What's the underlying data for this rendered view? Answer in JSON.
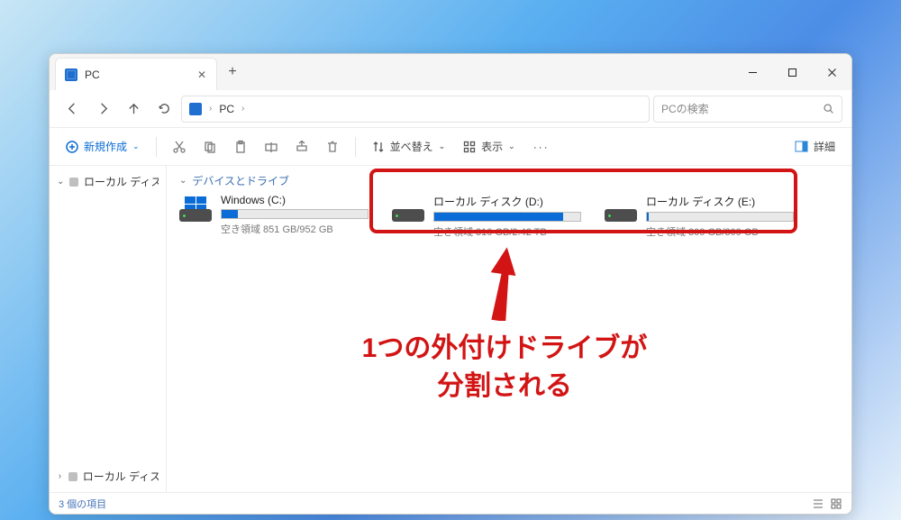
{
  "tab": {
    "title": "PC"
  },
  "breadcrumb": {
    "location": "PC"
  },
  "search": {
    "placeholder": "PCの検索"
  },
  "toolbar": {
    "new_label": "新規作成",
    "sort_label": "並べ替え",
    "view_label": "表示",
    "details_label": "詳細"
  },
  "sidebar": {
    "items": [
      {
        "label": "ローカル ディスク (C:)"
      },
      {
        "label": "ローカル ディスク (E:)"
      }
    ]
  },
  "group": {
    "header": "デバイスとドライブ"
  },
  "drives": [
    {
      "name": "Windows (C:)",
      "free_text": "空き領域 851 GB/952 GB",
      "fill_pct": 11,
      "system": true
    },
    {
      "name": "ローカル ディスク (D:)",
      "free_text": "空き領域 310 GB/2.42 TB",
      "fill_pct": 88,
      "system": false
    },
    {
      "name": "ローカル ディスク (E:)",
      "free_text": "空き領域 309 GB/309 GB",
      "fill_pct": 1,
      "system": false
    }
  ],
  "annotation": {
    "line1": "1つの外付けドライブが",
    "line2": "分割される"
  },
  "status": {
    "count_text": "3 個の項目"
  }
}
